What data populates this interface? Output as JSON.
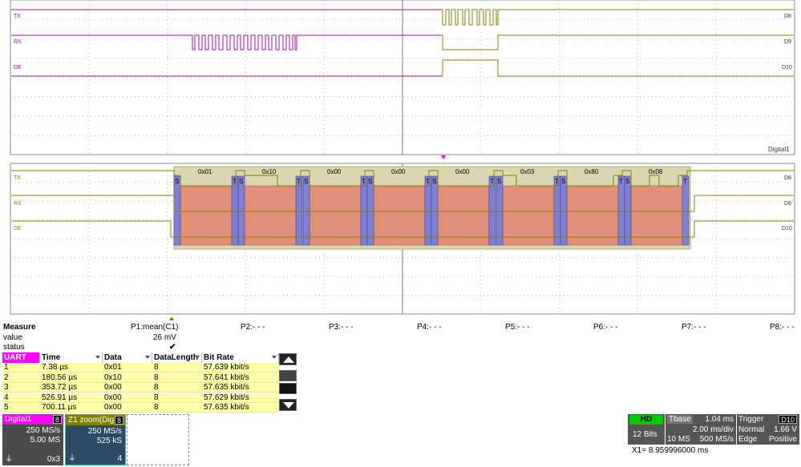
{
  "top_grid": {
    "traces": [
      {
        "label": "TX",
        "right_label": "D8"
      },
      {
        "label": "RX",
        "right_label": "D9"
      },
      {
        "label": "DE",
        "right_label": "D10"
      }
    ],
    "name": "Digital1"
  },
  "zoom_grid": {
    "traces": [
      {
        "label": "TX",
        "right_label": "D8"
      },
      {
        "label": "RX",
        "right_label": "D9"
      },
      {
        "label": "DE",
        "right_label": "D10"
      }
    ],
    "bytes": [
      "0x01",
      "0x10",
      "0x00",
      "0x00",
      "0x00",
      "0x03",
      "0x80",
      "0x08"
    ],
    "start_marker": "S",
    "stop_marker": "T"
  },
  "measure": {
    "title": "Measure",
    "params": [
      "P1:mean(C1)",
      "P2:- - -",
      "P3:- - -",
      "P4:- - -",
      "P5:- - -",
      "P6:- - -",
      "P7:- - -",
      "P8:- - -"
    ],
    "value_label": "value",
    "value": "26 mV",
    "status_label": "status",
    "status": "✔"
  },
  "uart_table": {
    "columns": [
      "UART",
      "Time",
      "Data",
      "DataLength",
      "Bit Rate"
    ],
    "rows": [
      {
        "idx": "1",
        "time": "7.38 µs",
        "data": "0x01",
        "len": "8",
        "rate": "57.639 kbit/s"
      },
      {
        "idx": "2",
        "time": "180.56 µs",
        "data": "0x10",
        "len": "8",
        "rate": "57.641 kbit/s"
      },
      {
        "idx": "3",
        "time": "353.72 µs",
        "data": "0x00",
        "len": "8",
        "rate": "57.635 kbit/s"
      },
      {
        "idx": "4",
        "time": "526.91 µs",
        "data": "0x00",
        "len": "8",
        "rate": "57.629 kbit/s"
      },
      {
        "idx": "5",
        "time": "700.11 µs",
        "data": "0x00",
        "len": "8",
        "rate": "57.635 kbit/s"
      }
    ]
  },
  "descriptors": {
    "digital1": {
      "title": "Digital1",
      "badge": "8",
      "line1": "250 MS/s",
      "line2": "5.00 MS",
      "footer": "0x3"
    },
    "z1": {
      "title": "Z1 zoom(Dig",
      "badge": "8",
      "line1": "250 MS/s",
      "line2": "525 kS",
      "footer": "4"
    }
  },
  "acq": {
    "mode": "HD",
    "bits": "12 Bits",
    "tbase_label": "Tbase",
    "tbase_val": "1.04 ms",
    "div": "2.00 ms/div",
    "samples": "10 MS",
    "rate": "500 MS/s",
    "trig_label": "Trigger",
    "trig_src": "D10",
    "trig_mode": "Normal",
    "trig_level": "1.66 V",
    "trig_type": "Edge",
    "trig_slope": "Positive",
    "cursor": "X1=   8.959996000 ms"
  },
  "colors": {
    "digital_purple": "#a010a0",
    "digital_olive": "#808000",
    "frame_fill": "#d9d6b0",
    "data_fill": "#e0907a",
    "bit_fill": "#8080d0",
    "uart_header": "#ff00ff",
    "row_fill": "#ffffa8"
  }
}
